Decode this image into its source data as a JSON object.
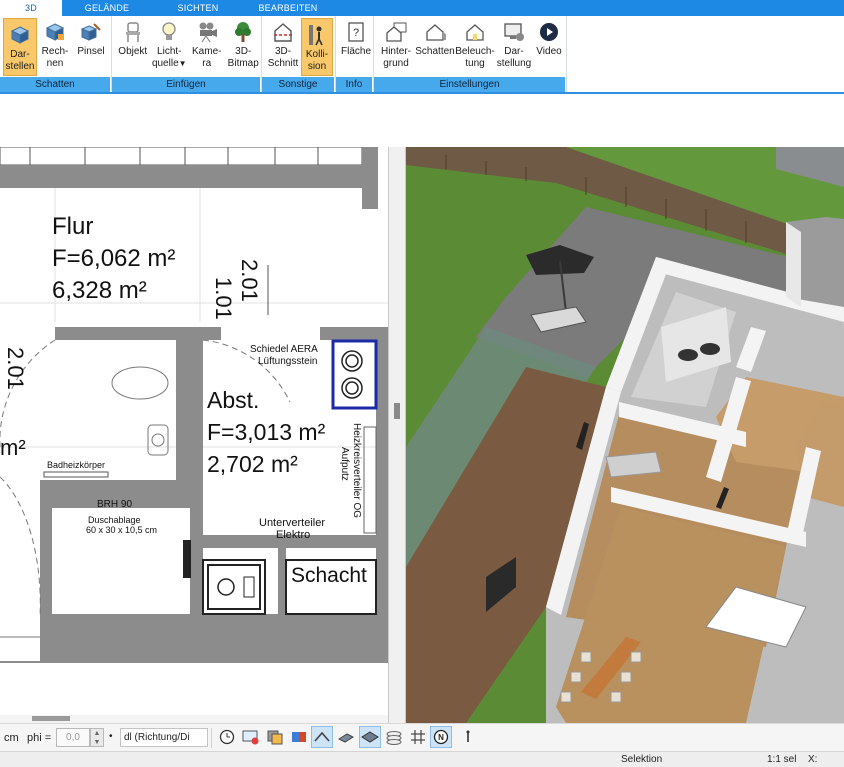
{
  "ribbon": {
    "tabs": [
      "3D",
      "GELÄNDE",
      "SICHTEN",
      "BEARBEITEN"
    ],
    "groups": {
      "schatten": {
        "label": "Schatten",
        "darstellen": [
          "Dar-",
          "stellen"
        ],
        "rechnen": [
          "Rech-",
          "nen"
        ],
        "pinsel": "Pinsel"
      },
      "einfuegen": {
        "label": "Einfügen",
        "objekt": "Objekt",
        "lichtquelle": [
          "Licht-",
          "quelle"
        ],
        "kamera": [
          "Kame-",
          "ra"
        ],
        "bitmap": [
          "3D-",
          "Bitmap"
        ]
      },
      "sonstige": {
        "label": "Sonstige",
        "schnitt": [
          "3D-",
          "Schnitt"
        ],
        "kollision": [
          "Kolli-",
          "sion"
        ]
      },
      "info": {
        "label": "Info",
        "flaeche": "Fläche"
      },
      "einstellungen": {
        "label": "Einstellungen",
        "hintergrund": [
          "Hinter-",
          "grund"
        ],
        "schatten": "Schatten",
        "beleuchtung": [
          "Beleuch-",
          "tung"
        ],
        "darstellung": [
          "Dar-",
          "stellung"
        ],
        "video": "Video"
      }
    }
  },
  "plan": {
    "flur_name": "Flur",
    "flur_area": "F=6,062 m²",
    "flur_area2": "6,328 m²",
    "dim_101": "1.01",
    "dim_201": "2.01",
    "dim_201_left": "2.01",
    "frag_m2": "m²",
    "schiedel_1": "Schiedel AERA",
    "schiedel_2": "Lüftungsstein",
    "abst_name": "Abst.",
    "abst_area": "F=3,013 m²",
    "abst_area2": "2,702 m²",
    "heizkreis_1": "Heizkreisverteiler OG",
    "heizkreis_2": "Aufputz",
    "badheiz": "Badheizkörper",
    "brh": "BRH 90",
    "dusch_1": "Duschablage",
    "dusch_2": "60 x 30 x 10,5 cm",
    "unterverteiler_1": "Unterverteiler",
    "unterverteiler_2": "Elektro",
    "schacht": "Schacht"
  },
  "toolbar": {
    "unit": "cm",
    "phi_label": "phi =",
    "phi_value": "0,0",
    "mode_select": "dl (Richtung/Di",
    "icons": [
      "clock-icon",
      "screen-icon",
      "layers-icon",
      "palette-icon",
      "roof-icon",
      "wall-icon",
      "floor-icon",
      "stack-icon",
      "grid-icon",
      "north-icon",
      "info-icon"
    ]
  },
  "status": {
    "mode": "Selektion",
    "scale": "1:1 sel",
    "x_label": "X:"
  },
  "colors": {
    "ribbon_blue": "#1e88e5",
    "group_label_blue": "#45a9ec",
    "active_button": "#f8c86a",
    "wall_gray": "#8c8c8c",
    "grass": "#5c8b36"
  }
}
